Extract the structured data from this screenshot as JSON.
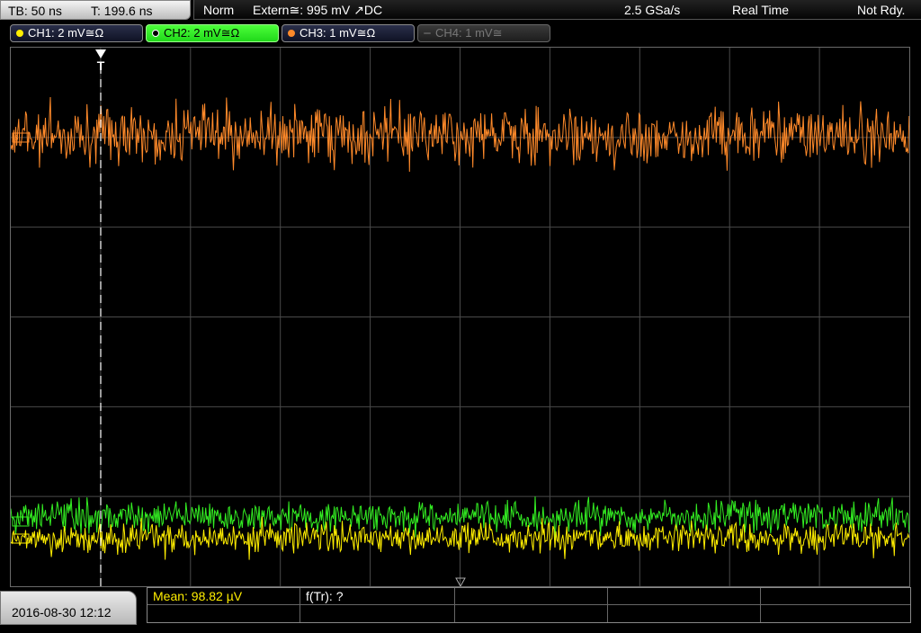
{
  "topbar": {
    "timebase": "TB: 50 ns",
    "trigger_pos": "T: 199.6 ns",
    "trigger_mode": "Norm",
    "trigger_source": "Extern≅: 995 mV ↗DC",
    "sample_rate": "2.5 GSa/s",
    "acq_mode": "Real Time",
    "status": "Not Rdy."
  },
  "channels": [
    {
      "label": "CH1: 2 mV≅Ω",
      "color": "#ffee00",
      "state": "on"
    },
    {
      "label": "CH2: 2 mV≅Ω",
      "color": "#33ff22",
      "state": "selected"
    },
    {
      "label": "CH3: 1 mV≅Ω",
      "color": "#ff8a2a",
      "state": "on"
    },
    {
      "label": "CH4: 1 mV≅",
      "color": "#777777",
      "state": "off"
    }
  ],
  "screen": {
    "trigger_marker": "T",
    "grid_color": "#4a4a4a",
    "trace_colors": {
      "ch3": "#ff8a2a",
      "ch2": "#33ee22",
      "ch1": "#ffee00"
    }
  },
  "footer": {
    "datetime": "2016-08-30 12:12",
    "mean": "Mean: 98.82 µV",
    "freq": "f(Tr): ?"
  }
}
